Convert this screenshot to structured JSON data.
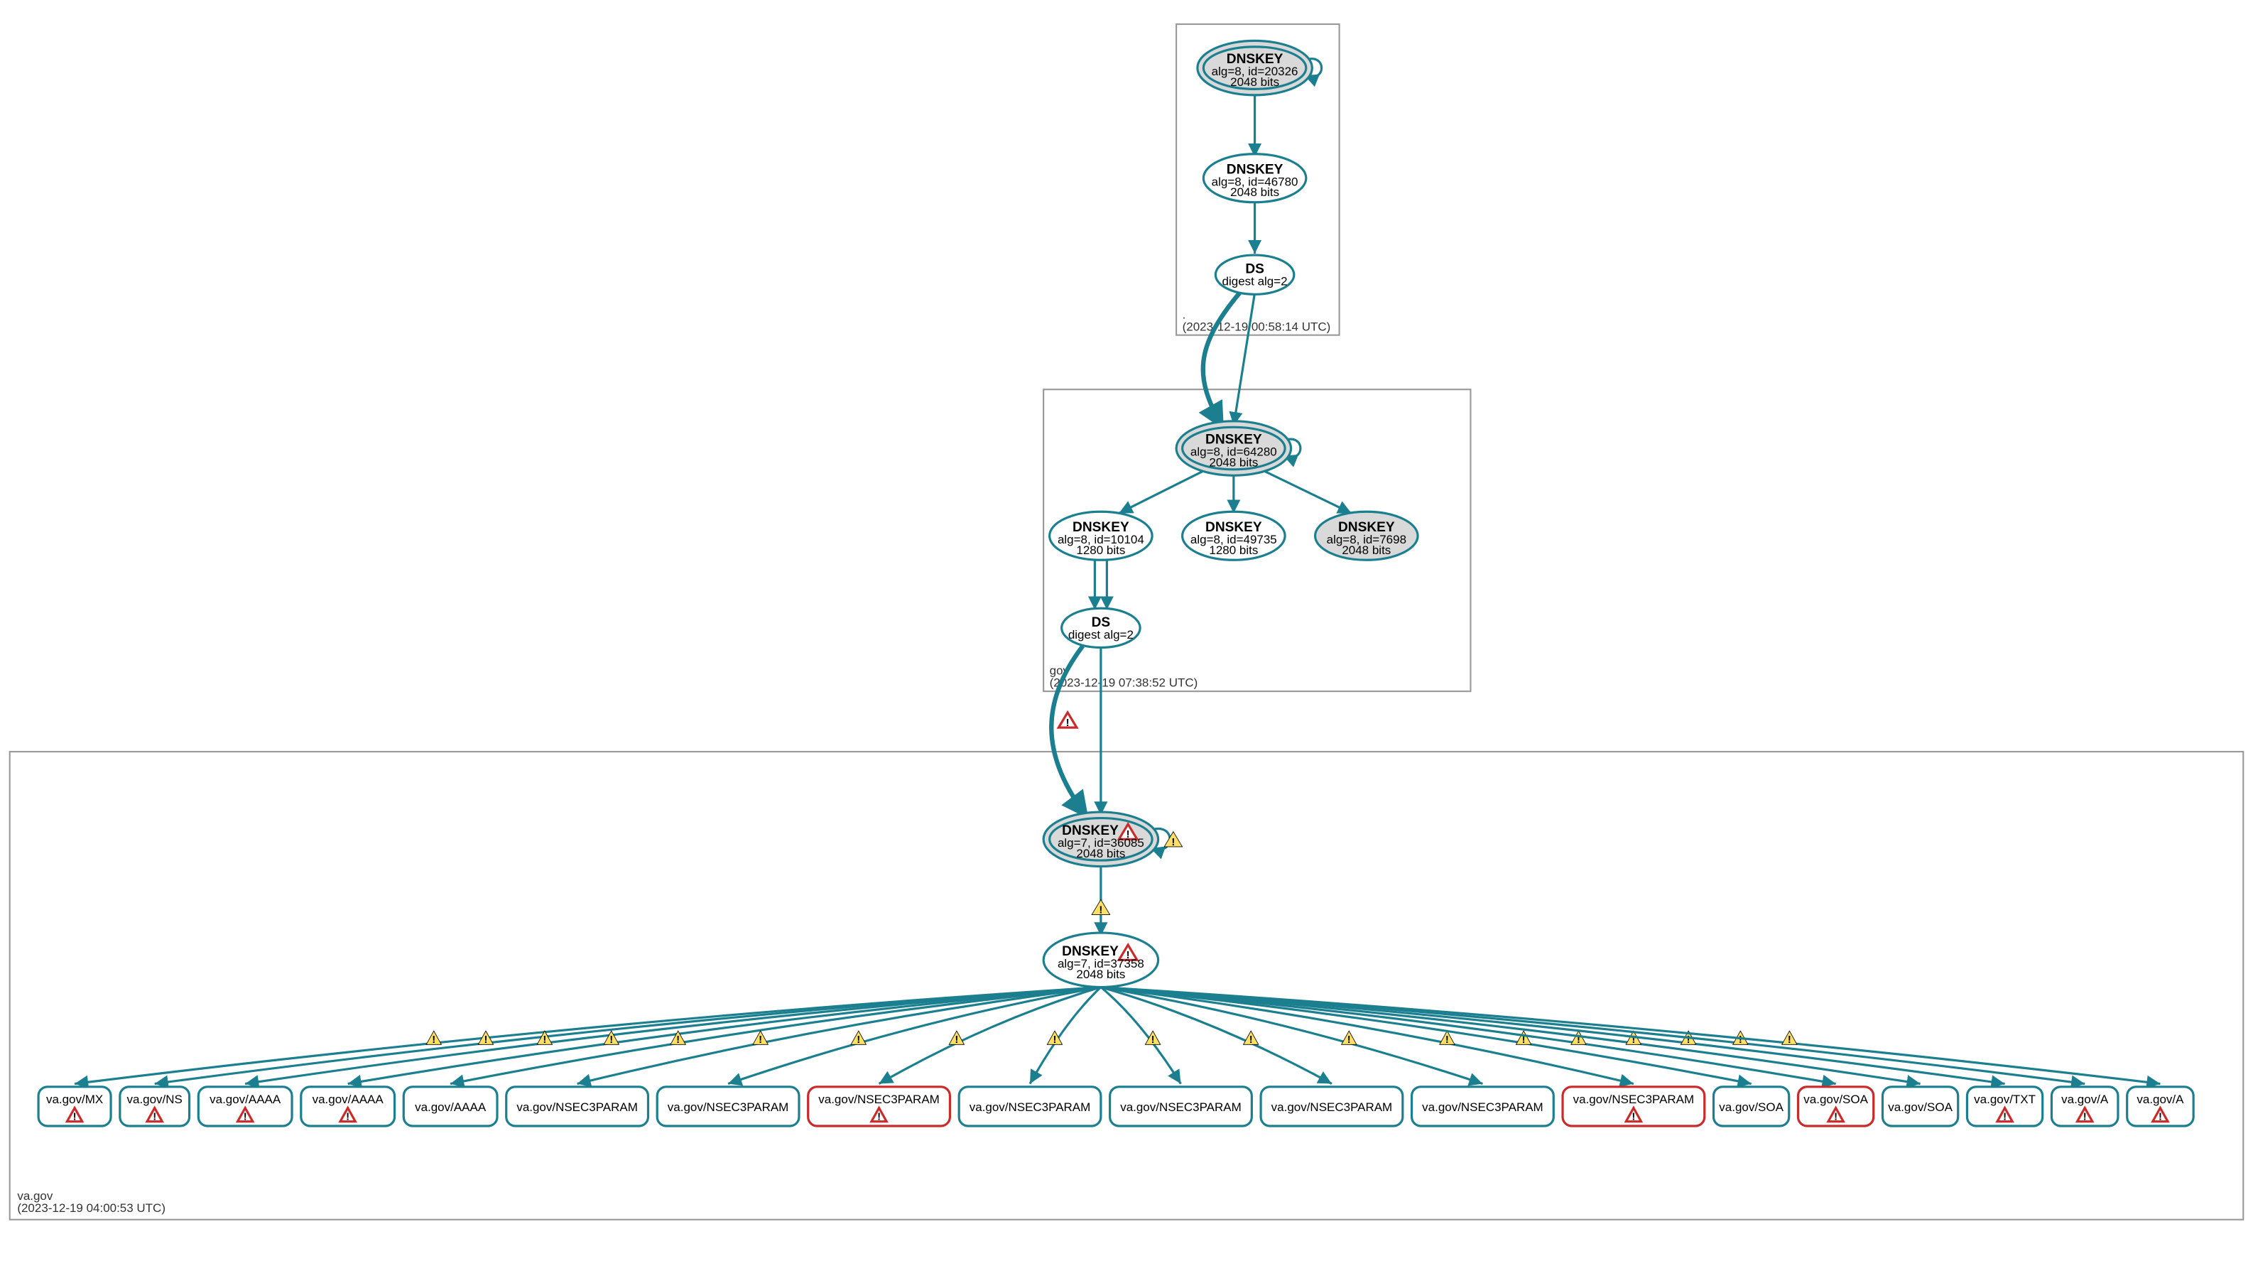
{
  "colors": {
    "teal": "#1b7f8f",
    "grayFill": "#d9d9d9",
    "whiteFill": "#ffffff",
    "redStroke": "#c92a2a",
    "yellowFill": "#ffe066"
  },
  "zones": {
    "root": {
      "title": ".",
      "timestamp": "(2023-12-19 00:58:14 UTC)"
    },
    "gov": {
      "title": "gov",
      "timestamp": "(2023-12-19 07:38:52 UTC)"
    },
    "vagov": {
      "title": "va.gov",
      "timestamp": "(2023-12-19 04:00:53 UTC)"
    }
  },
  "nodes": {
    "root_ksk": {
      "title": "DNSKEY",
      "line1": "alg=8, id=20326",
      "line2": "2048 bits",
      "fill": "gray",
      "doubleStroke": true,
      "selfLoop": true
    },
    "root_zsk": {
      "title": "DNSKEY",
      "line1": "alg=8, id=46780",
      "line2": "2048 bits",
      "fill": "white"
    },
    "root_ds": {
      "title": "DS",
      "line1": "digest alg=2",
      "fill": "white"
    },
    "gov_ksk": {
      "title": "DNSKEY",
      "line1": "alg=8, id=64280",
      "line2": "2048 bits",
      "fill": "gray",
      "doubleStroke": true,
      "selfLoop": true
    },
    "gov_zsk1": {
      "title": "DNSKEY",
      "line1": "alg=8, id=10104",
      "line2": "1280 bits",
      "fill": "white"
    },
    "gov_zsk2": {
      "title": "DNSKEY",
      "line1": "alg=8, id=49735",
      "line2": "1280 bits",
      "fill": "white"
    },
    "gov_key3": {
      "title": "DNSKEY",
      "line1": "alg=8, id=7698",
      "line2": "2048 bits",
      "fill": "gray"
    },
    "gov_ds": {
      "title": "DS",
      "line1": "digest alg=2",
      "fill": "white"
    },
    "vagov_ksk": {
      "title": "DNSKEY",
      "line1": "alg=7, id=36085",
      "line2": "2048 bits",
      "fill": "gray",
      "doubleStroke": true,
      "selfLoop": true,
      "warnRed": true,
      "selfLoopWarnYellow": true
    },
    "vagov_zsk": {
      "title": "DNSKEY",
      "line1": "alg=7, id=37358",
      "line2": "2048 bits",
      "fill": "white",
      "warnRed": true
    }
  },
  "leafNodes": [
    {
      "label": "va.gov/MX",
      "warn": "red",
      "edgeWarn": "yellow",
      "border": "teal"
    },
    {
      "label": "va.gov/NS",
      "warn": "red",
      "edgeWarn": "yellow",
      "border": "teal"
    },
    {
      "label": "va.gov/AAAA",
      "warn": "red",
      "edgeWarn": "yellow",
      "border": "teal"
    },
    {
      "label": "va.gov/AAAA",
      "warn": "red",
      "edgeWarn": "yellow",
      "border": "teal"
    },
    {
      "label": "va.gov/AAAA",
      "warn": null,
      "edgeWarn": "yellow",
      "border": "teal"
    },
    {
      "label": "va.gov/NSEC3PARAM",
      "warn": null,
      "edgeWarn": "yellow",
      "border": "teal"
    },
    {
      "label": "va.gov/NSEC3PARAM",
      "warn": null,
      "edgeWarn": "yellow",
      "border": "teal"
    },
    {
      "label": "va.gov/NSEC3PARAM",
      "warn": "red",
      "edgeWarn": "yellow",
      "border": "red"
    },
    {
      "label": "va.gov/NSEC3PARAM",
      "warn": null,
      "edgeWarn": "yellow",
      "border": "teal"
    },
    {
      "label": "va.gov/NSEC3PARAM",
      "warn": null,
      "edgeWarn": "yellow",
      "border": "teal"
    },
    {
      "label": "va.gov/NSEC3PARAM",
      "warn": null,
      "edgeWarn": "yellow",
      "border": "teal"
    },
    {
      "label": "va.gov/NSEC3PARAM",
      "warn": null,
      "edgeWarn": "yellow",
      "border": "teal"
    },
    {
      "label": "va.gov/NSEC3PARAM",
      "warn": "red",
      "edgeWarn": "yellow",
      "border": "red"
    },
    {
      "label": "va.gov/SOA",
      "warn": null,
      "edgeWarn": "yellow",
      "border": "teal"
    },
    {
      "label": "va.gov/SOA",
      "warn": "red",
      "edgeWarn": "yellow",
      "border": "red"
    },
    {
      "label": "va.gov/SOA",
      "warn": null,
      "edgeWarn": "yellow",
      "border": "teal"
    },
    {
      "label": "va.gov/TXT",
      "warn": "red",
      "edgeWarn": "yellow",
      "border": "teal"
    },
    {
      "label": "va.gov/A",
      "warn": "red",
      "edgeWarn": "yellow",
      "border": "teal"
    },
    {
      "label": "va.gov/A",
      "warn": "red",
      "edgeWarn": "yellow",
      "border": "teal"
    }
  ],
  "edges": {
    "root_ksk_to_zsk": {
      "from": "root_ksk",
      "to": "root_zsk"
    },
    "root_zsk_to_ds": {
      "from": "root_zsk",
      "to": "root_ds"
    },
    "root_ds_to_gov_ksk_bold": {
      "from": "root_ds",
      "to": "gov_ksk",
      "bold": true,
      "curved": true
    },
    "root_ds_to_gov_ksk": {
      "from": "root_ds",
      "to": "gov_ksk"
    },
    "gov_ksk_to_zsk1": {
      "from": "gov_ksk",
      "to": "gov_zsk1"
    },
    "gov_ksk_to_zsk2": {
      "from": "gov_ksk",
      "to": "gov_zsk2"
    },
    "gov_ksk_to_key3": {
      "from": "gov_ksk",
      "to": "gov_key3"
    },
    "gov_zsk1_to_ds": {
      "from": "gov_zsk1",
      "to": "gov_ds"
    },
    "gov_ds_to_vagov_ksk_bold": {
      "from": "gov_ds",
      "to": "vagov_ksk",
      "bold": true,
      "curved": true,
      "warnRed": true
    },
    "gov_ds_to_vagov_ksk": {
      "from": "gov_ds",
      "to": "vagov_ksk"
    },
    "vagov_ksk_to_zsk": {
      "from": "vagov_ksk",
      "to": "vagov_zsk",
      "warnYellow": true
    }
  }
}
